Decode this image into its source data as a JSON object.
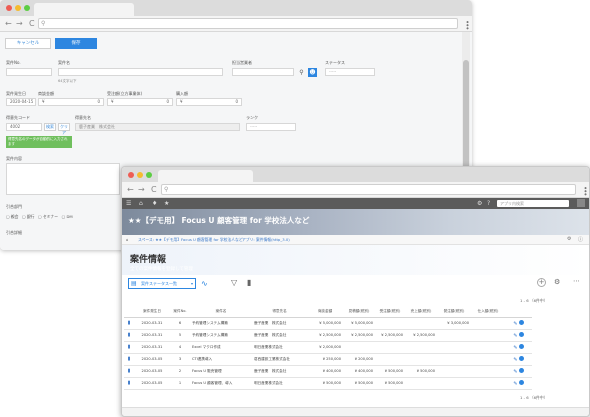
{
  "colors": {
    "accent": "#2d86e0",
    "appbar": "#5b5b5b",
    "green_button": "#6fbf5d"
  },
  "browser": {
    "back_icon": "←",
    "forward_icon": "→",
    "reload_icon": "C",
    "menu_icon": "⋮"
  },
  "back_form": {
    "cancel_label": "キャンセル",
    "save_label": "保存",
    "labels": {
      "case_no": "案件No.",
      "case_name": "案件名",
      "case_name_hint": "64文字以下",
      "owner": "担当営業者",
      "status": "ステータス",
      "status_placeholder": "-----",
      "occurred_date": "案件発生日",
      "merchandise_amount": "商談金額",
      "order_amount": "受注額(立方事業体)",
      "purchase_amount": "購入額",
      "client_code": "得意先コード",
      "client_name": "得意先名",
      "rank": "ランク",
      "rank_placeholder": "-----",
      "case_content": "案件内容",
      "related_dept": "引合部門",
      "related_detail": "引合詳細"
    },
    "date_value": "2020-04-15",
    "currency_mark": "¥",
    "zero": "0",
    "client_code_value": "4002",
    "search_btn": "検索",
    "clear_btn": "クリア",
    "client_name_value": "鹿子産業　株式会社",
    "green_note": "得意先名のデータが自動的に入力されます",
    "checkboxes": [
      "親会",
      "銀行",
      "セミナー",
      "DM",
      "電話",
      "その他"
    ]
  },
  "front_app": {
    "app_search_placeholder": "アプリ内検索",
    "hero_title": "★★【デモ用】 Focus U 顧客管理 for 学校法人など",
    "breadcrumb": [
      "ホーム",
      "スペース: ★★【デモ用】Focus U 顧客管理 for 学校法人など",
      "アプリ: 案件情報(http_3.0)"
    ],
    "page_title": "案件情報",
    "page_subtitle": "全ての案件情報を登録して管理",
    "view_select": "案件ステータス一覧",
    "pager_top": "1 - 6 （6件中）",
    "pager_bottom": "1 - 6 （6件中）",
    "table": {
      "headers": [
        "",
        "案件発生日",
        "案件No.",
        "案件名",
        "得意先名",
        "商談金額",
        "見積額(税別)",
        "受注額(税別)",
        "売上額(税別)",
        "発注額(税別)",
        "仕入額(税別)",
        ""
      ],
      "rows": [
        {
          "date": "2020-03-31",
          "no": "6",
          "name": "予約管理システム構築",
          "client": "鹿子産業　株式会社",
          "v1": "¥ 5,000,000",
          "v2": "¥ 5,000,000",
          "v3": "",
          "v4": "",
          "v5": "¥ 3,000,000",
          "v6": ""
        },
        {
          "date": "2020-03-31",
          "no": "5",
          "name": "予約管理システム構築",
          "client": "鹿子産業　株式会社",
          "v1": "¥ 2,500,000",
          "v2": "¥ 2,500,000",
          "v3": "¥ 2,500,000",
          "v4": "¥ 2,500,000",
          "v5": "",
          "v6": ""
        },
        {
          "date": "2020-03-31",
          "no": "4",
          "name": "Excel マクロ作成",
          "client": "明日産業株式会社",
          "v1": "¥ 2,000,000",
          "v2": "",
          "v3": "",
          "v4": "",
          "v5": "",
          "v6": ""
        },
        {
          "date": "2020-03-05",
          "no": "3",
          "name": "CTI連携導入",
          "client": "葛西建設工業株式会社",
          "v1": "¥ 250,000",
          "v2": "¥ 200,000",
          "v3": "",
          "v4": "",
          "v5": "",
          "v6": ""
        },
        {
          "date": "2020-03-05",
          "no": "2",
          "name": "Focus U 販売管理",
          "client": "鹿子産業　株式会社",
          "v1": "¥ 400,000",
          "v2": "¥ 400,000",
          "v3": "¥ 500,000",
          "v4": "¥ 500,000",
          "v5": "",
          "v6": ""
        },
        {
          "date": "2020-03-05",
          "no": "1",
          "name": "Focus U 顧客管理、導入",
          "client": "明日産業株式会社",
          "v1": "¥ 500,000",
          "v2": "¥ 500,000",
          "v3": "¥ 500,000",
          "v4": "",
          "v5": "",
          "v6": ""
        }
      ]
    }
  }
}
